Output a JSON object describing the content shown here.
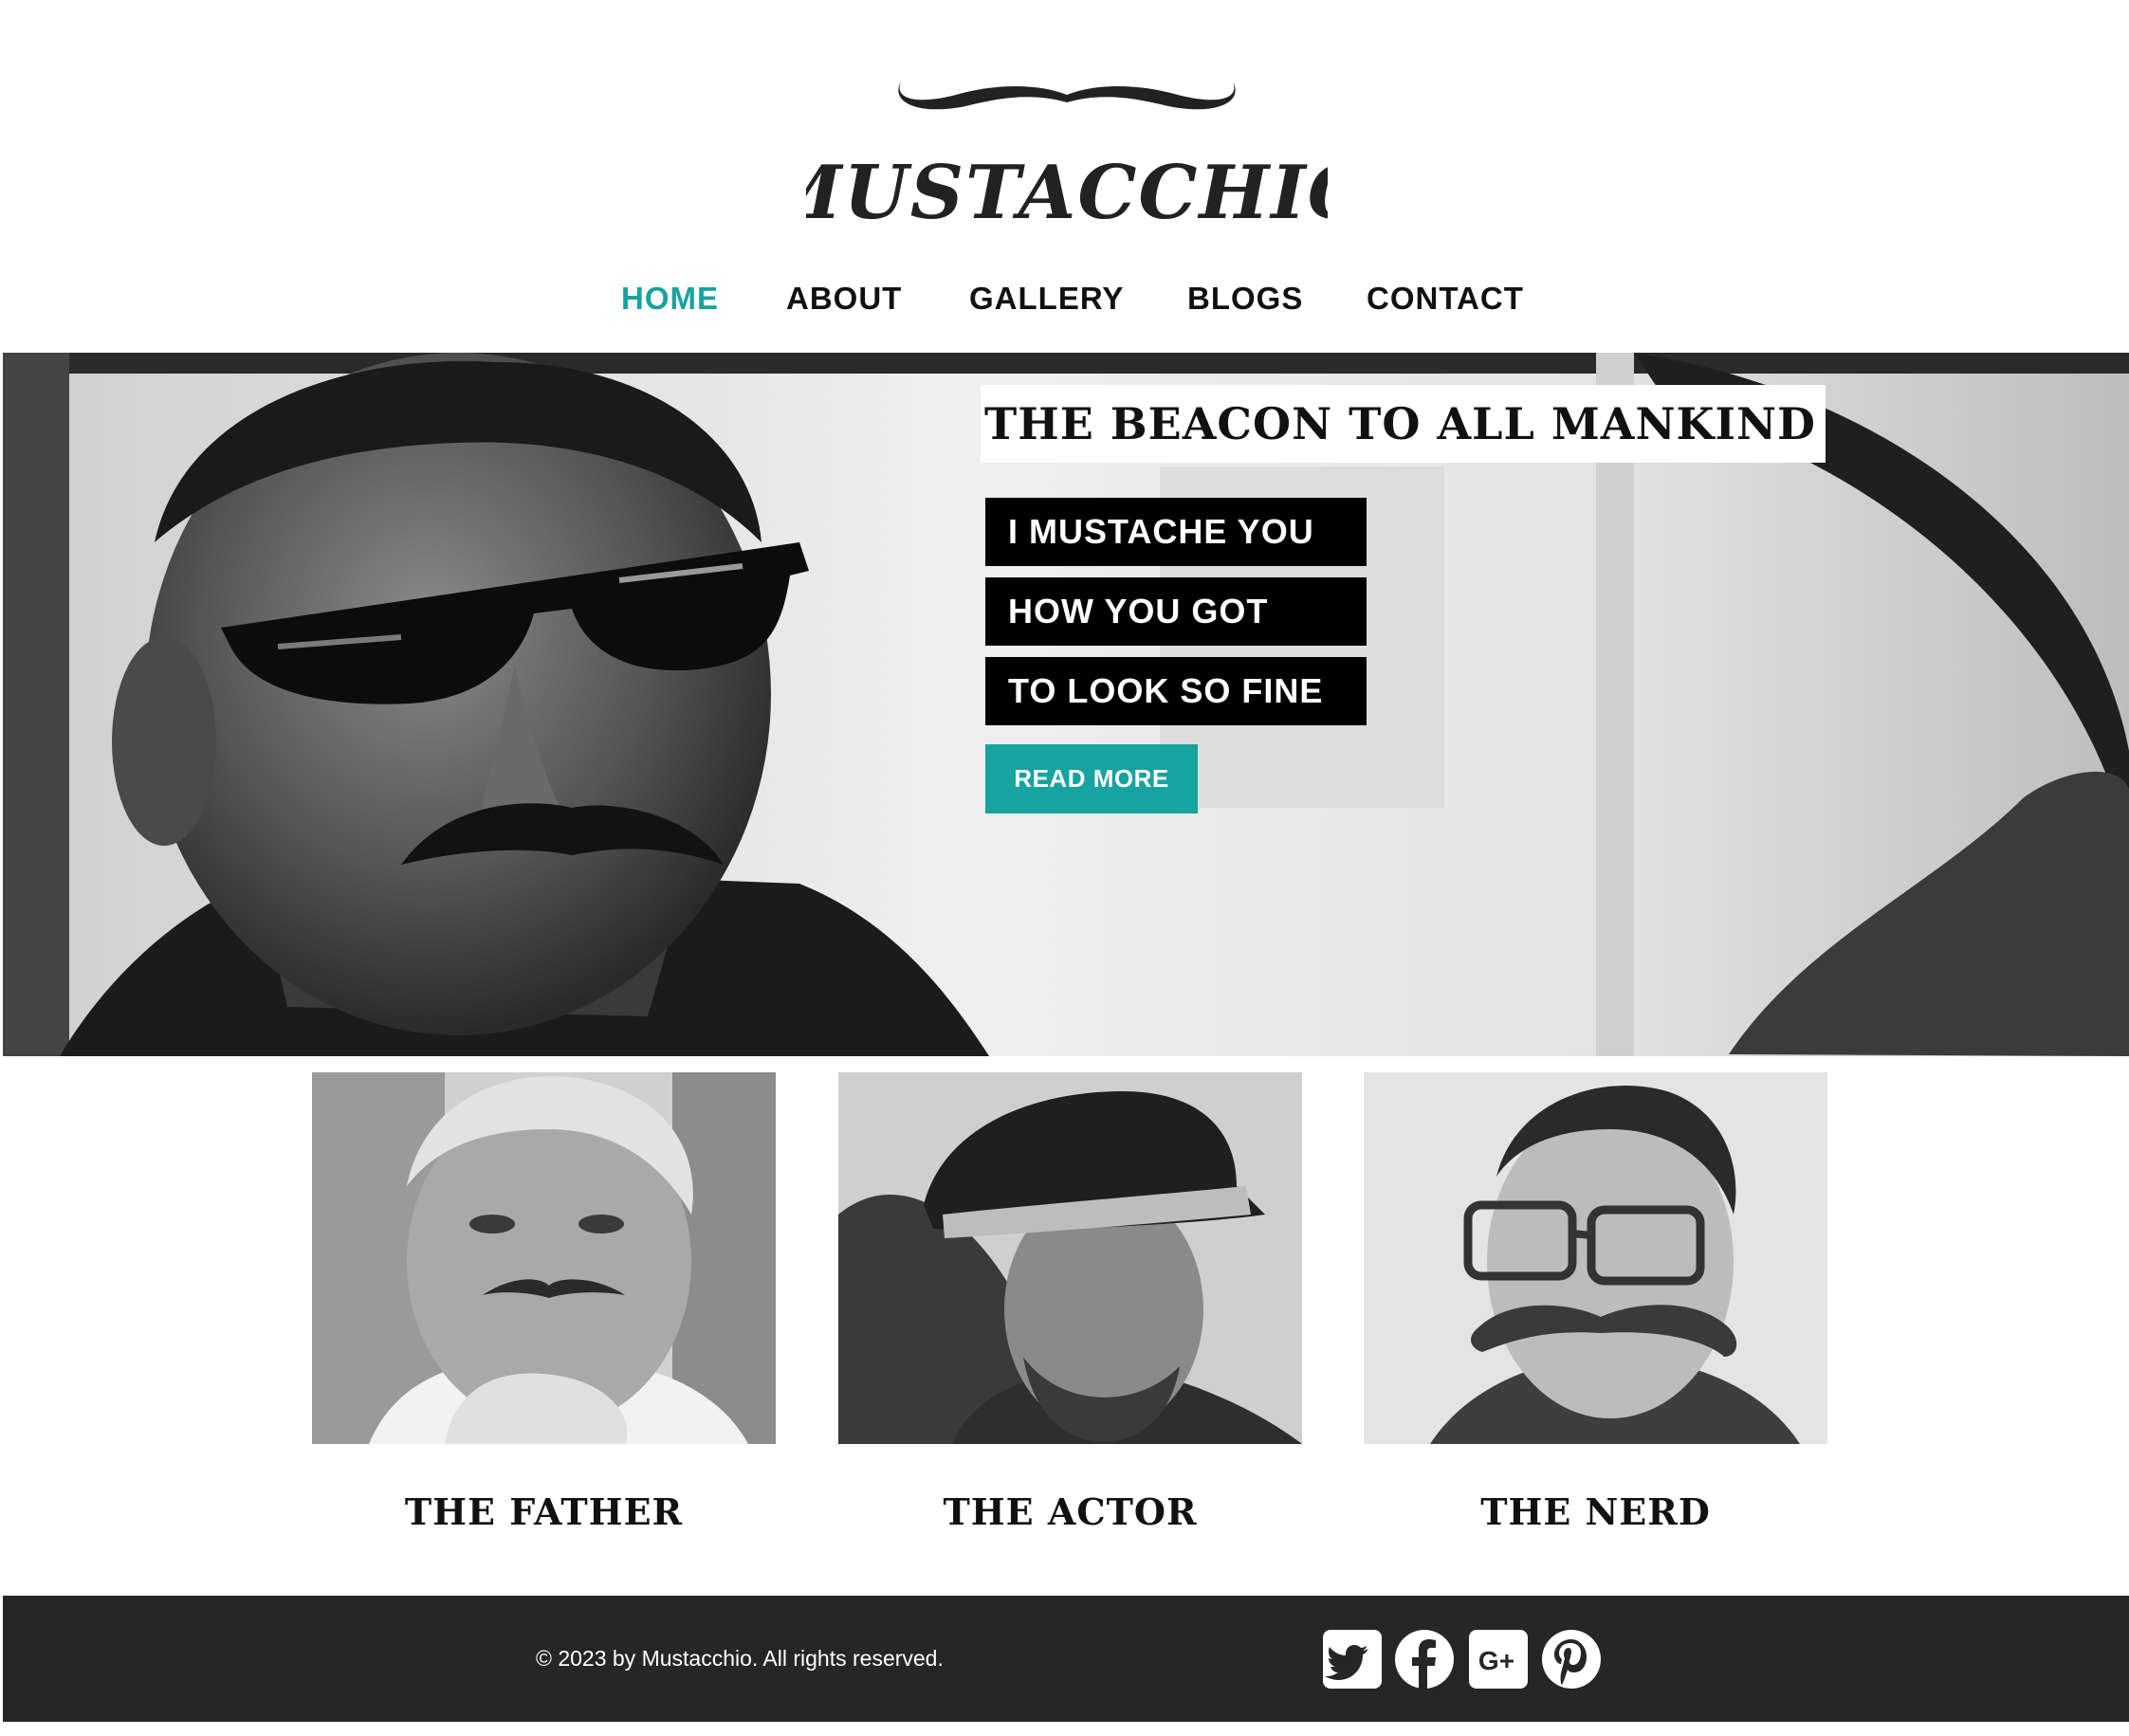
{
  "brand": {
    "logo_text": "MUSTACCHIO"
  },
  "nav": {
    "items": [
      {
        "label": "HOME",
        "active": true
      },
      {
        "label": "ABOUT",
        "active": false
      },
      {
        "label": "GALLERY",
        "active": false
      },
      {
        "label": "BLOGS",
        "active": false
      },
      {
        "label": "CONTACT",
        "active": false
      }
    ]
  },
  "hero": {
    "title": "THE BEACON TO ALL MANKIND",
    "lines": [
      "I MUSTACHE YOU",
      "HOW YOU GOT",
      "TO LOOK SO FINE"
    ],
    "button_label": "READ MORE",
    "image": "black-and-white photo of a man with sunglasses and a mustache driving a car"
  },
  "cards": [
    {
      "caption": "THE FATHER",
      "image": "grayscale portrait of an older man with a mustache resting his chin on his hand"
    },
    {
      "caption": "THE ACTOR",
      "image": "grayscale portrait of a smiling bearded man in a fedora hat"
    },
    {
      "caption": "THE NERD",
      "image": "grayscale portrait of a man with glasses and a curled handlebar mustache"
    }
  ],
  "footer": {
    "copyright": "© 2023 by Mustacchio. All rights reserved.",
    "social": [
      "twitter-icon",
      "facebook-icon",
      "google-plus-icon",
      "pinterest-icon"
    ]
  },
  "colors": {
    "accent": "#17a3a0",
    "footer_bg": "#262626",
    "text": "#111111"
  }
}
